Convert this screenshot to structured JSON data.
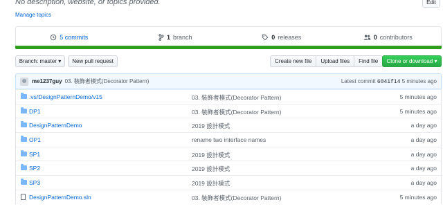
{
  "header": {
    "description": "No description, website, or topics provided.",
    "edit_label": "Edit",
    "manage_topics": "Manage topics"
  },
  "summary": {
    "commits": "5 commits",
    "branches_count": "1",
    "branches_label": "branch",
    "releases_count": "0",
    "releases_label": "releases",
    "contributors_count": "0",
    "contributors_label": "contributors"
  },
  "toolbar": {
    "branch_label": "Branch: master",
    "new_pr": "New pull request",
    "create_file": "Create new file",
    "upload_files": "Upload files",
    "find_file": "Find file",
    "clone": "Clone or download"
  },
  "commit": {
    "author": "me1237guy",
    "message": "03. 裝飾者模式(Decorator Pattern)",
    "latest_prefix": "Latest commit",
    "sha": "6041f14",
    "age": "5 minutes ago"
  },
  "files": [
    {
      "type": "folder",
      "name": ".vs/DesignPatternDemo/v15",
      "message": "03. 裝飾者模式(Decorator Pattern)",
      "age": "5 minutes ago"
    },
    {
      "type": "folder",
      "name": "DP1",
      "message": "03. 裝飾者模式(Decorator Pattern)",
      "age": "5 minutes ago"
    },
    {
      "type": "folder",
      "name": "DesignPatternDemo",
      "message": "2019 設計模式",
      "age": "a day ago"
    },
    {
      "type": "folder",
      "name": "OP1",
      "message": "rename two interface names",
      "age": "a day ago"
    },
    {
      "type": "folder",
      "name": "SP1",
      "message": "2019 設計模式",
      "age": "a day ago"
    },
    {
      "type": "folder",
      "name": "SP2",
      "message": "2019 設計模式",
      "age": "a day ago"
    },
    {
      "type": "folder",
      "name": "SP3",
      "message": "2019 設計模式",
      "age": "a day ago"
    },
    {
      "type": "file",
      "name": "DesignPatternDemo.sln",
      "message": "03. 裝飾者模式(Decorator Pattern)",
      "age": "5 minutes ago"
    }
  ],
  "colors": {
    "link": "#0366d6",
    "language_bar": "#2f9e1c",
    "clone_button": "#28a745",
    "commit_bar_bg": "#f1f8ff"
  },
  "icons": {
    "commits": "history-icon",
    "branch": "git-branch-icon",
    "releases": "tag-icon",
    "contributors": "people-icon",
    "folder": "folder-icon",
    "file": "file-icon"
  }
}
